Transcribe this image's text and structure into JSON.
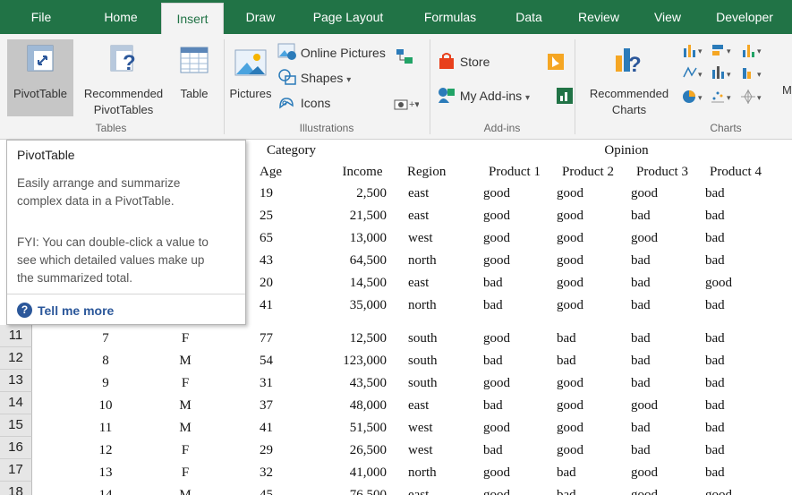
{
  "colors": {
    "accent": "#217346",
    "link": "#2b579a"
  },
  "tabs": [
    "File",
    "Home",
    "Insert",
    "Draw",
    "Page Layout",
    "Formulas",
    "Data",
    "Review",
    "View",
    "Developer"
  ],
  "active_tab": "Insert",
  "ribbon": {
    "tables": {
      "pivottable": "PivotTable",
      "recommended_line1": "Recommended",
      "recommended_line2": "PivotTables",
      "table": "Table",
      "group": "Tables"
    },
    "illustrations": {
      "pictures": "Pictures",
      "online_pictures": "Online Pictures",
      "shapes": "Shapes",
      "icons": "Icons",
      "group": "Illustrations"
    },
    "addins": {
      "store": "Store",
      "my_addins": "My Add-ins",
      "group": "Add-ins"
    },
    "charts": {
      "recommended_line1": "Recommended",
      "recommended_line2": "Charts",
      "group": "Charts",
      "overflow": "M"
    }
  },
  "tooltip": {
    "title": "PivotTable",
    "line1": "Easily arrange and summarize",
    "line2": "complex data in a PivotTable.",
    "line3": "FYI: You can double-click a value to",
    "line4": "see which detailed values make up",
    "line5": "the summarized total.",
    "link": "Tell me more",
    "help_glyph": "?"
  },
  "sheet": {
    "header1": {
      "category": "Category",
      "opinion": "Opinion"
    },
    "header2": {
      "age": "Age",
      "income": "Income",
      "region": "Region",
      "p1": "Product 1",
      "p2": "Product 2",
      "p3": "Product 3",
      "p4": "Product 4"
    },
    "visible_rows": [
      {
        "age": "19",
        "income": "2,500",
        "region": "east",
        "p1": "good",
        "p2": "good",
        "p3": "good",
        "p4": "bad"
      },
      {
        "age": "25",
        "income": "21,500",
        "region": "east",
        "p1": "good",
        "p2": "good",
        "p3": "bad",
        "p4": "bad"
      },
      {
        "age": "65",
        "income": "13,000",
        "region": "west",
        "p1": "good",
        "p2": "good",
        "p3": "good",
        "p4": "bad"
      },
      {
        "age": "43",
        "income": "64,500",
        "region": "north",
        "p1": "good",
        "p2": "good",
        "p3": "bad",
        "p4": "bad"
      },
      {
        "age": "20",
        "income": "14,500",
        "region": "east",
        "p1": "bad",
        "p2": "good",
        "p3": "bad",
        "p4": "good"
      },
      {
        "age": "41",
        "income": "35,000",
        "region": "north",
        "p1": "bad",
        "p2": "good",
        "p3": "bad",
        "p4": "bad"
      }
    ],
    "rows": [
      {
        "rownum": "11",
        "id": "7",
        "gender": "F",
        "age": "77",
        "income": "12,500",
        "region": "south",
        "p1": "good",
        "p2": "bad",
        "p3": "bad",
        "p4": "bad"
      },
      {
        "rownum": "12",
        "id": "8",
        "gender": "M",
        "age": "54",
        "income": "123,000",
        "region": "south",
        "p1": "bad",
        "p2": "bad",
        "p3": "bad",
        "p4": "bad"
      },
      {
        "rownum": "13",
        "id": "9",
        "gender": "F",
        "age": "31",
        "income": "43,500",
        "region": "south",
        "p1": "good",
        "p2": "good",
        "p3": "bad",
        "p4": "bad"
      },
      {
        "rownum": "14",
        "id": "10",
        "gender": "M",
        "age": "37",
        "income": "48,000",
        "region": "east",
        "p1": "bad",
        "p2": "good",
        "p3": "good",
        "p4": "bad"
      },
      {
        "rownum": "15",
        "id": "11",
        "gender": "M",
        "age": "41",
        "income": "51,500",
        "region": "west",
        "p1": "good",
        "p2": "good",
        "p3": "bad",
        "p4": "bad"
      },
      {
        "rownum": "16",
        "id": "12",
        "gender": "F",
        "age": "29",
        "income": "26,500",
        "region": "west",
        "p1": "bad",
        "p2": "good",
        "p3": "bad",
        "p4": "bad"
      },
      {
        "rownum": "17",
        "id": "13",
        "gender": "F",
        "age": "32",
        "income": "41,000",
        "region": "north",
        "p1": "good",
        "p2": "bad",
        "p3": "good",
        "p4": "bad"
      },
      {
        "rownum": "18",
        "id": "14",
        "gender": "M",
        "age": "45",
        "income": "76,500",
        "region": "east",
        "p1": "good",
        "p2": "bad",
        "p3": "good",
        "p4": "good"
      }
    ]
  }
}
